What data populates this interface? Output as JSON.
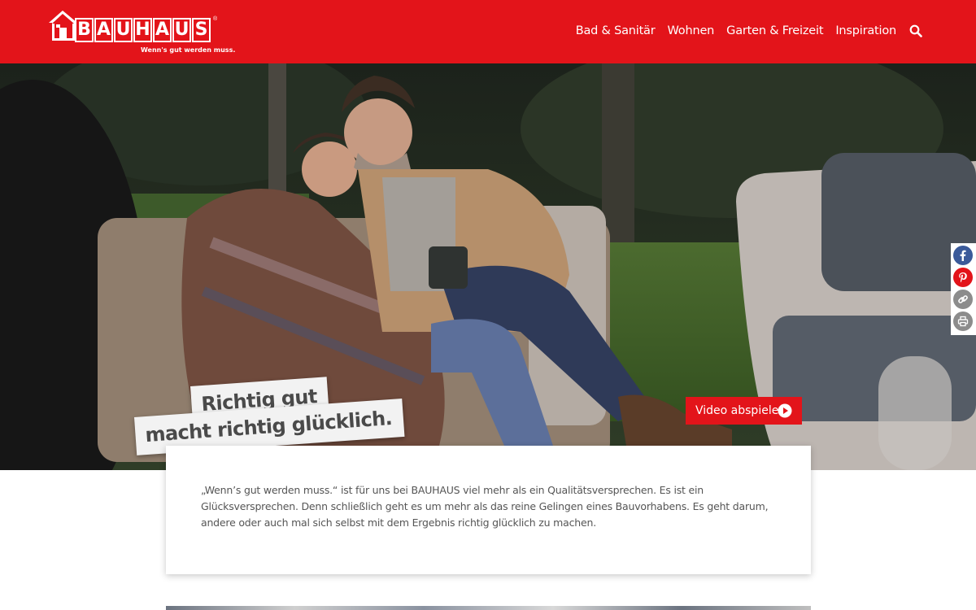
{
  "header": {
    "brand": "BAUHAUS",
    "registered_mark": "®",
    "tagline": "Wenn's gut werden muss.",
    "nav_items": [
      {
        "label": "Bad & Sanitär"
      },
      {
        "label": "Wohnen"
      },
      {
        "label": "Garten & Freizeit"
      },
      {
        "label": "Inspiration"
      }
    ],
    "search_icon": "search-icon"
  },
  "hero": {
    "headline_line1": "Richtig gut",
    "headline_line2": "macht richtig glücklich.",
    "video_button_label": "Video abspielen",
    "video_icon": "play-circle-icon"
  },
  "share": {
    "items": [
      {
        "icon": "facebook-icon",
        "color": "#3b5a9a"
      },
      {
        "icon": "pinterest-icon",
        "color": "#e3141a"
      },
      {
        "icon": "link-icon",
        "color": "#8c8c8c"
      },
      {
        "icon": "print-icon",
        "color": "#8c8c8c"
      }
    ]
  },
  "content": {
    "intro": "„Wenn’s gut werden muss.“ ist für uns bei BAUHAUS viel mehr als ein Qualitätsversprechen. Es ist ein Glücksversprechen. Denn schließlich geht es um mehr als das reine Gelingen eines Bauvorhabens. Es geht darum, andere oder auch mal sich selbst mit dem Ergebnis richtig glücklich zu machen."
  },
  "colors": {
    "brand_red": "#e3141a",
    "text_gray": "#555555",
    "headline_gray": "#4a4a4a"
  }
}
